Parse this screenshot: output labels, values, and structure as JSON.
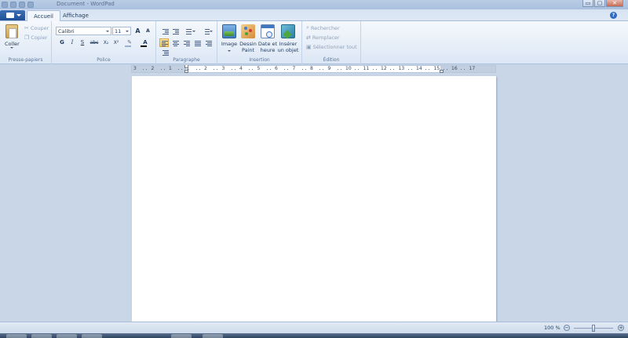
{
  "window": {
    "title": "Document - WordPad",
    "controls": {
      "minimize": "▭",
      "maximize": "▢",
      "close": "✕"
    }
  },
  "tabs": [
    {
      "label": "Accueil",
      "active": true
    },
    {
      "label": "Affichage",
      "active": false
    }
  ],
  "help_label": "?",
  "ribbon": {
    "clipboard": {
      "label": "Presse-papiers",
      "paste": "Coller",
      "cut": "Couper",
      "copy": "Copier"
    },
    "font": {
      "label": "Police",
      "family": "Calibri",
      "size": "11",
      "grow": "A",
      "shrink": "A",
      "bold": "G",
      "italic": "I",
      "underline": "S",
      "strike": "abc",
      "subscript": "X₂",
      "superscript": "X²"
    },
    "paragraph": {
      "label": "Paragraphe"
    },
    "insertion": {
      "label": "Insertion",
      "image": "Image",
      "paint_line1": "Dessin",
      "paint_line2": "Paint",
      "datetime_line1": "Date et",
      "datetime_line2": "heure",
      "object_line1": "Insérer",
      "object_line2": "un objet"
    },
    "editing": {
      "label": "Édition",
      "find": "Rechercher",
      "replace": "Remplacer",
      "select_all": "Sélectionner tout"
    }
  },
  "ruler": {
    "ticks": [
      "3",
      "2",
      "1",
      "1",
      "2",
      "3",
      "4",
      "5",
      "6",
      "7",
      "8",
      "9",
      "10",
      "11",
      "12",
      "13",
      "14",
      "15",
      "16",
      "17"
    ]
  },
  "status": {
    "zoom_label": "100 %",
    "zoom_out": "−",
    "zoom_in": "+",
    "zoom_level": 0.5
  },
  "colors": {
    "accent": "#1e4f97",
    "highlight": "#f8c65a",
    "page": "#ffffff"
  }
}
